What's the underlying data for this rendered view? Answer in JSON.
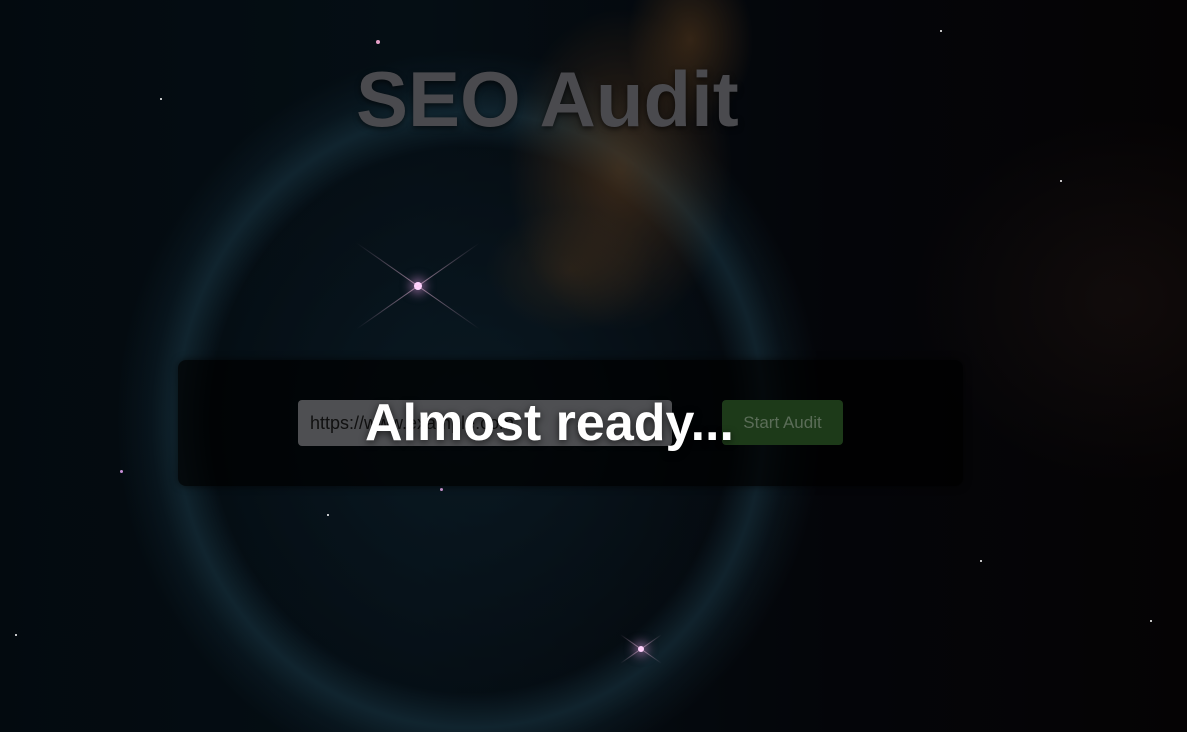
{
  "page": {
    "title": "SEO Audit"
  },
  "audit_form": {
    "url_value": "https://www.example.com",
    "start_label": "Start Audit"
  },
  "loading_overlay": {
    "message": "Almost ready..."
  },
  "colors": {
    "title": "#4a4a4e",
    "panel_bg": "rgba(0,0,0,0.72)",
    "button_bg": "#1d3a19",
    "button_text": "#5b6d58",
    "overlay_text": "#ffffff"
  }
}
